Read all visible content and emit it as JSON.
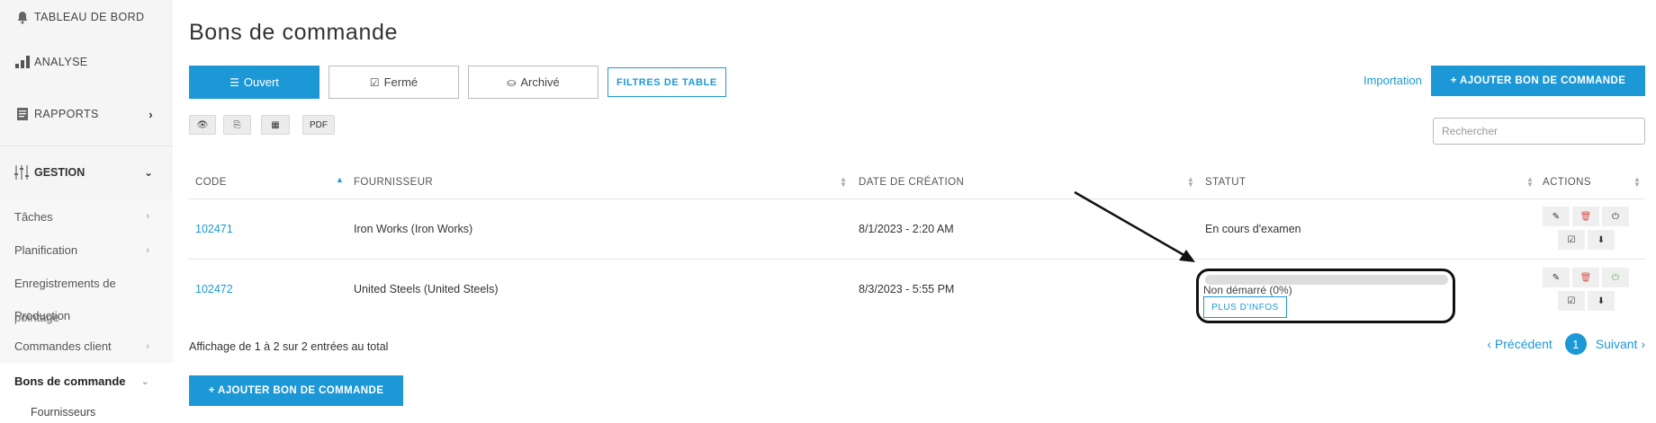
{
  "sidebar": {
    "dashboard": "TABLEAU DE BORD",
    "analyse": "ANALYSE",
    "rapports": "RAPPORTS",
    "gestion": "GESTION",
    "items": [
      {
        "label": "Tâches"
      },
      {
        "label": "Planification"
      },
      {
        "label": "Enregistrements de",
        "line2": "Production",
        "line2b": "pointage"
      },
      {
        "label": "Commandes client"
      },
      {
        "label": "Bons de commande"
      }
    ],
    "child": "Fournisseurs"
  },
  "page": {
    "title": "Bons de commande"
  },
  "tabs": [
    {
      "label": "Ouvert",
      "icon": "list-icon"
    },
    {
      "label": "Fermé",
      "icon": "check-square-icon"
    },
    {
      "label": "Archivé",
      "icon": "inbox-icon"
    }
  ],
  "filter_button": "FILTRES DE TABLE",
  "import_link": "Importation",
  "add_button": "+ AJOUTER BON DE COMMANDE",
  "tools": {
    "pdf": "PDF"
  },
  "search": {
    "placeholder": "Rechercher"
  },
  "table": {
    "headers": {
      "code": "CODE",
      "fournisseur": "FOURNISSEUR",
      "date": "DATE DE CRÉATION",
      "statut": "STATUT",
      "actions": "ACTIONS"
    },
    "rows": [
      {
        "code": "102471",
        "fournisseur": "Iron Works (Iron Works)",
        "date": "8/1/2023 - 2:20 AM",
        "statut": "En cours d'examen"
      },
      {
        "code": "102472",
        "fournisseur": "United Steels (United Steels)",
        "date": "8/3/2023 - 5:55 PM",
        "statut": "Non démarré (0%)",
        "progress": 0,
        "more": "PLUS D'INFOS"
      }
    ]
  },
  "info": "Affichage de 1 à 2 sur 2 entrées au total",
  "pager": {
    "prev": "‹ Précédent",
    "page": "1",
    "next": "Suivant ›"
  },
  "colors": {
    "accent": "#1d98d6",
    "delete": "#d9534f",
    "active_power": "#5cb85c"
  }
}
